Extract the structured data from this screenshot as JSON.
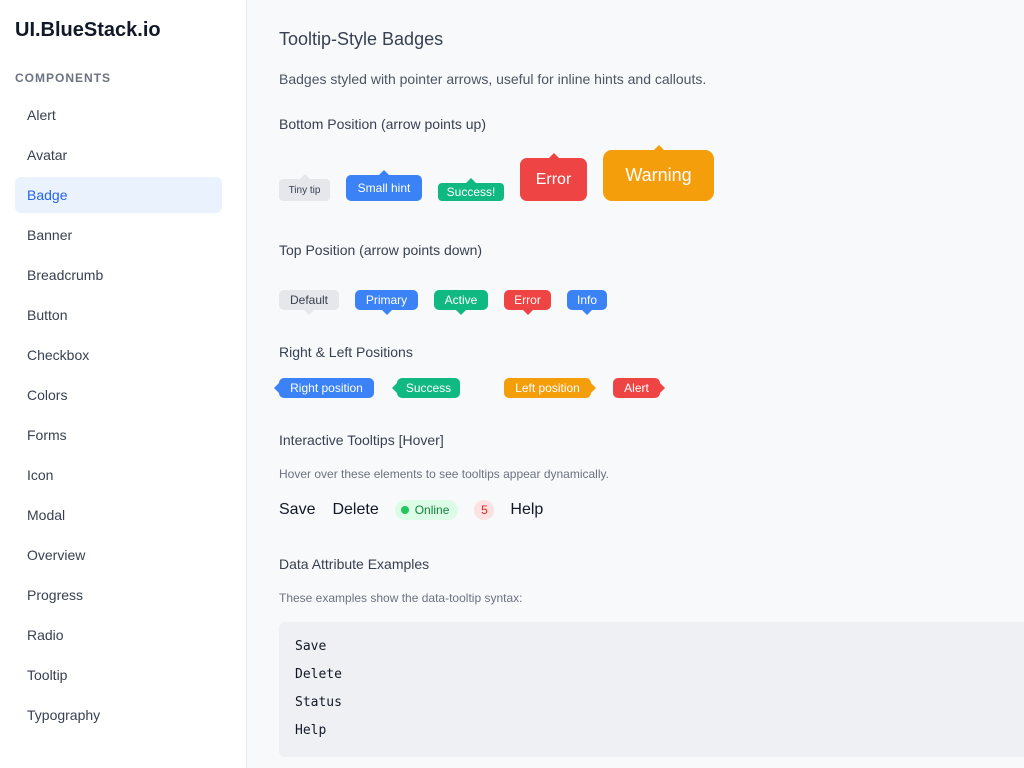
{
  "sidebar": {
    "brand": "UI.BlueStack.io",
    "section_label": "COMPONENTS",
    "items": [
      {
        "label": "Alert"
      },
      {
        "label": "Avatar"
      },
      {
        "label": "Badge"
      },
      {
        "label": "Banner"
      },
      {
        "label": "Breadcrumb"
      },
      {
        "label": "Button"
      },
      {
        "label": "Checkbox"
      },
      {
        "label": "Colors"
      },
      {
        "label": "Forms"
      },
      {
        "label": "Icon"
      },
      {
        "label": "Modal"
      },
      {
        "label": "Overview"
      },
      {
        "label": "Progress"
      },
      {
        "label": "Radio"
      },
      {
        "label": "Tooltip"
      },
      {
        "label": "Typography"
      }
    ],
    "active_item": "Badge"
  },
  "main": {
    "title": "Tooltip-Style Badges",
    "description": "Badges styled with pointer arrows, useful for inline hints and callouts.",
    "bottom_section": {
      "title": "Bottom Position (arrow points up)",
      "badges": [
        {
          "label": "Tiny tip",
          "color": "#e5e7eb"
        },
        {
          "label": "Small hint",
          "color": "#3b82f6"
        },
        {
          "label": "Success!",
          "color": "#10b981"
        },
        {
          "label": "Error",
          "color": "#ef4444"
        },
        {
          "label": "Warning",
          "color": "#f59e0b"
        }
      ]
    },
    "top_section": {
      "title": "Top Position (arrow points down)",
      "badges": [
        {
          "label": "Default",
          "color": "#e5e7eb"
        },
        {
          "label": "Primary",
          "color": "#3b82f6"
        },
        {
          "label": "Active",
          "color": "#10b981"
        },
        {
          "label": "Error",
          "color": "#ef4444"
        },
        {
          "label": "Info",
          "color": "#3b82f6"
        }
      ]
    },
    "side_section": {
      "title": "Right & Left Positions",
      "badges": [
        {
          "label": "Right position",
          "color": "#3b82f6"
        },
        {
          "label": "Success",
          "color": "#10b981"
        },
        {
          "label": "Left position",
          "color": "#f59e0b"
        },
        {
          "label": "Alert",
          "color": "#ef4444"
        }
      ]
    },
    "interactive_section": {
      "title": "Interactive Tooltips [Hover]",
      "note": "Hover over these elements to see tooltips appear dynamically.",
      "save": "Save",
      "delete": "Delete",
      "online": "Online",
      "count": "5",
      "help": "Help"
    },
    "data_attr_section": {
      "title": "Data Attribute Examples",
      "note": "These examples show the data-tooltip syntax:",
      "code_lines": [
        "Save",
        "Delete",
        "Status",
        "Help"
      ]
    }
  }
}
